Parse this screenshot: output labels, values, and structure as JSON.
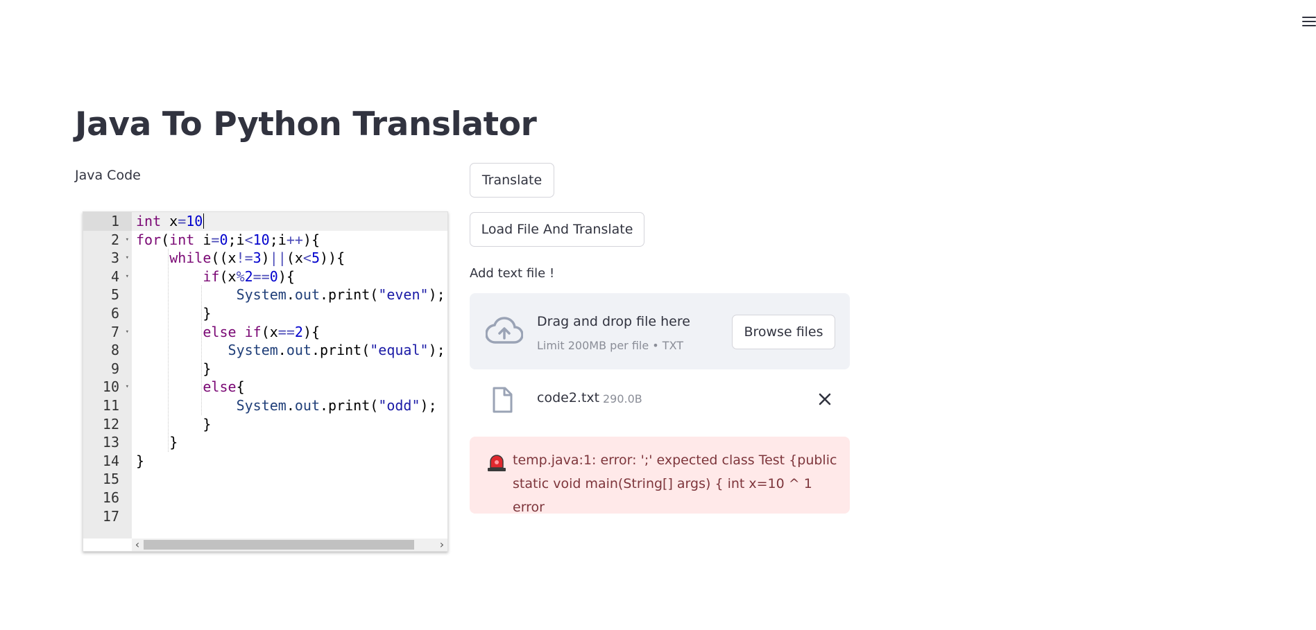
{
  "header": {
    "menu_icon": "hamburger-menu-icon"
  },
  "page_title": "Java To Python Translator",
  "editor": {
    "label": "Java Code",
    "lines": [
      {
        "num": "1",
        "text": "int x=10",
        "fold": false,
        "indent": 0
      },
      {
        "num": "2",
        "text": "for(int i=0;i<10;i++){",
        "fold": true,
        "indent": 0
      },
      {
        "num": "3",
        "text": "while((x!=3)||(x<5)){",
        "fold": true,
        "indent": 1
      },
      {
        "num": "4",
        "text": "if(x%2==0){",
        "fold": true,
        "indent": 2
      },
      {
        "num": "5",
        "text": "System.out.print(\"even\");",
        "fold": false,
        "indent": 3
      },
      {
        "num": "6",
        "text": "}",
        "fold": false,
        "indent": 2
      },
      {
        "num": "7",
        "text": "else if(x==2){",
        "fold": true,
        "indent": 2
      },
      {
        "num": "8",
        "text": "System.out.print(\"equal\");",
        "fold": false,
        "indent": 2.75
      },
      {
        "num": "9",
        "text": "}",
        "fold": false,
        "indent": 2
      },
      {
        "num": "10",
        "text": "else{",
        "fold": true,
        "indent": 2
      },
      {
        "num": "11",
        "text": "System.out.print(\"odd\");",
        "fold": false,
        "indent": 3
      },
      {
        "num": "12",
        "text": "}",
        "fold": false,
        "indent": 2
      },
      {
        "num": "13",
        "text": "}",
        "fold": false,
        "indent": 1
      },
      {
        "num": "14",
        "text": "}",
        "fold": false,
        "indent": 0
      },
      {
        "num": "15",
        "text": "",
        "fold": false,
        "indent": 0
      },
      {
        "num": "16",
        "text": "",
        "fold": false,
        "indent": 0
      },
      {
        "num": "17",
        "text": "",
        "fold": false,
        "indent": 0
      }
    ],
    "syntax_colors": {
      "keyword": "#7a0874",
      "number": "#0000cd",
      "string": "#1a1aa6",
      "object": "#1f3e78",
      "operator": "#4a4ab8"
    }
  },
  "actions": {
    "translate_label": "Translate",
    "load_label": "Load File And Translate"
  },
  "uploader": {
    "label": "Add text file !",
    "dropzone_title": "Drag and drop file here",
    "dropzone_subtitle": "Limit 200MB per file • TXT",
    "browse_label": "Browse files",
    "icon": "cloud-upload-icon"
  },
  "file": {
    "name": "code2.txt",
    "size": "290.0B",
    "icon": "file-icon",
    "remove_icon": "close-icon"
  },
  "error": {
    "icon": "siren-icon",
    "message": "temp.java:1: error: ';' expected class Test {public static void main(String[] args) { int x=10 ^ 1 error",
    "background": "#ffe9e9",
    "text_color": "#7d353b"
  }
}
